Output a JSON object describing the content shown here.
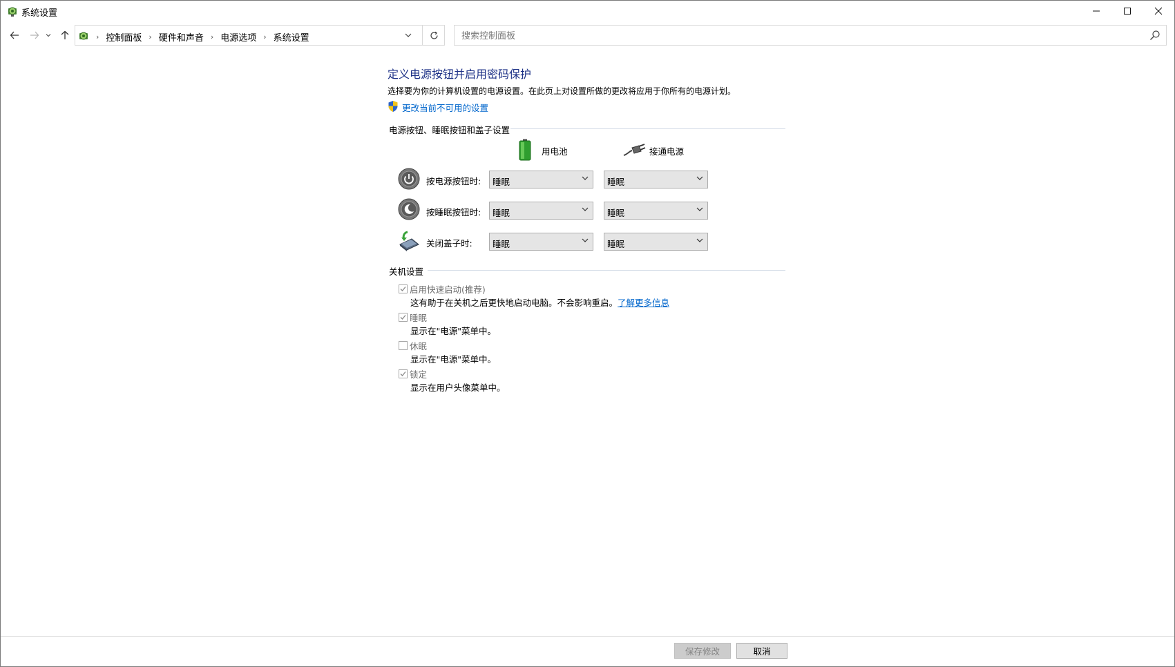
{
  "window": {
    "title": "系统设置"
  },
  "nav": {
    "breadcrumbs": [
      "控制面板",
      "硬件和声音",
      "电源选项",
      "系统设置"
    ],
    "search_placeholder": "搜索控制面板"
  },
  "content": {
    "title": "定义电源按钮并启用密码保护",
    "description": "选择要为你的计算机设置的电源设置。在此页上对设置所做的更改将应用于你所有的电源计划。",
    "change_link": "更改当前不可用的设置",
    "buttons_section": {
      "title": "电源按钮、睡眠按钮和盖子设置",
      "col_battery": "用电池",
      "col_plugged": "接通电源",
      "rows": [
        {
          "label": "按电源按钮时:",
          "battery": "睡眠",
          "plugged": "睡眠"
        },
        {
          "label": "按睡眠按钮时:",
          "battery": "睡眠",
          "plugged": "睡眠"
        },
        {
          "label": "关闭盖子时:",
          "battery": "睡眠",
          "plugged": "睡眠"
        }
      ]
    },
    "shutdown_section": {
      "title": "关机设置",
      "items": [
        {
          "label": "启用快速启动(推荐)",
          "checked": true,
          "desc": "这有助于在关机之后更快地启动电脑。不会影响重启。",
          "link": "了解更多信息"
        },
        {
          "label": "睡眠",
          "checked": true,
          "desc": "显示在\"电源\"菜单中。"
        },
        {
          "label": "休眠",
          "checked": false,
          "desc": "显示在\"电源\"菜单中。"
        },
        {
          "label": "锁定",
          "checked": true,
          "desc": "显示在用户头像菜单中。"
        }
      ]
    }
  },
  "footer": {
    "save": "保存修改",
    "cancel": "取消"
  }
}
